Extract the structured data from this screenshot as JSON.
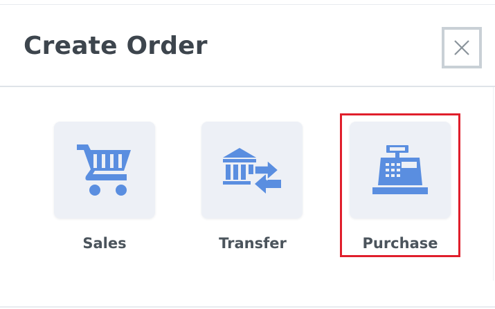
{
  "dialog": {
    "title": "Create Order",
    "close_icon": "close-icon"
  },
  "options": [
    {
      "label": "Sales",
      "icon": "shopping-cart-icon",
      "selected": false
    },
    {
      "label": "Transfer",
      "icon": "bank-transfer-icon",
      "selected": false
    },
    {
      "label": "Purchase",
      "icon": "cash-register-icon",
      "selected": true
    }
  ],
  "colors": {
    "icon_blue": "#5a8ee0",
    "tile_bg": "#edf0f6",
    "title_text": "#3d454d",
    "label_text": "#4b545c",
    "highlight": "#e01e2b",
    "close_border": "#c9d0d6"
  }
}
